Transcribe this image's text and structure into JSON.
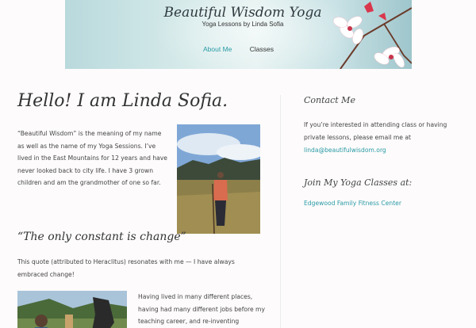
{
  "header": {
    "site_title": "Beautiful Wisdom Yoga",
    "tagline": "Yoga Lessons by Linda Sofia",
    "nav": [
      {
        "label": "About Me",
        "active": true
      },
      {
        "label": "Classes",
        "active": false
      }
    ],
    "accent_color": "#2a9ba7"
  },
  "main": {
    "heading": "Hello! I am Linda Sofia.",
    "intro": "“Beautiful Wisdom” is the meaning of my name as well as the name of my Yoga Sessions. I’ve lived in the East Mountains for 12 years and have never looked back to city life. I have 3 grown children and am the grandmother of one so far.",
    "quote_heading": "“The only constant is change”",
    "quote_text": "This quote (attributed to Heraclitus) resonates with me — I have always embraced change!",
    "lived_text": "Having lived in many different places, having had many different jobs before my teaching career, and re-inventing"
  },
  "sidebar": {
    "contact_heading": "Contact Me",
    "contact_text_before": "If you’re interested in attending class or having private lessons, please email me at ",
    "contact_email": "linda@beautifulwisdom.org",
    "join_heading": "Join My Yoga Classes at:",
    "join_link": "Edgewood Family Fitness Center"
  }
}
